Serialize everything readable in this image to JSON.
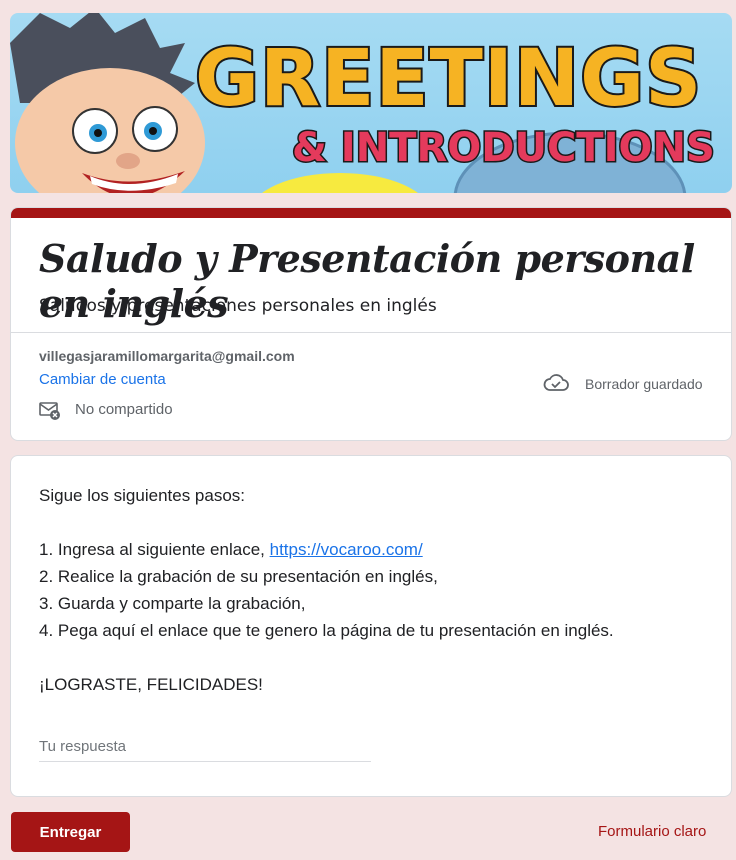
{
  "banner": {
    "title_line1": "GREETINGS",
    "title_line2": "& INTRODUCTIONS"
  },
  "form": {
    "title": "Saludo y Presentación personal en inglés",
    "description": "Saludos y presentaciones personales en inglés"
  },
  "account": {
    "email": "villegasjaramillomargarita@gmail.com",
    "switch_label": "Cambiar de cuenta",
    "not_shared": "No compartido",
    "not_shared_icon": "mail-not-shared-icon",
    "draft_status": "Borrador guardado",
    "draft_icon": "cloud-check-icon"
  },
  "question": {
    "line_intro": "Sigue los siguientes pasos:",
    "step1_prefix": "1. Ingresa al siguiente enlace, ",
    "step1_link": "https://vocaroo.com/",
    "step2": "2. Realice la grabación de su presentación en inglés,",
    "step3": "3. Guarda y comparte la grabación,",
    "step4": "4. Pega aquí el enlace que te genero la página de tu presentación en inglés.",
    "closing": "¡LOGRASTE, FELICIDADES!",
    "answer_placeholder": "Tu respuesta",
    "answer_value": ""
  },
  "footer": {
    "submit_label": "Entregar",
    "light_form_label": "Formulario claro"
  },
  "colors": {
    "accent": "#a51515",
    "link": "#1a73e8",
    "background": "#f4e3e3"
  }
}
